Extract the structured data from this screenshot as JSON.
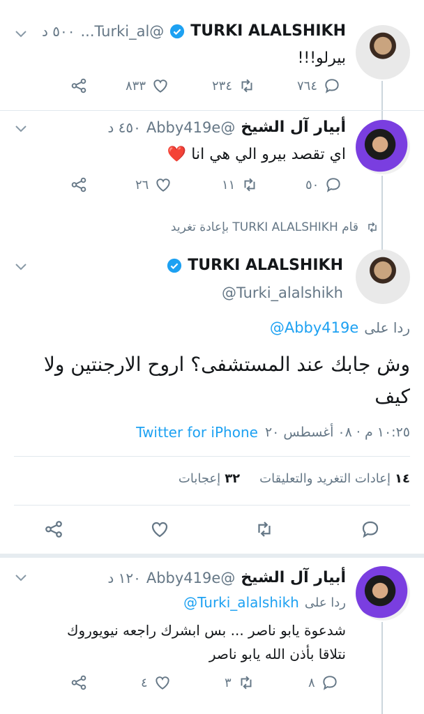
{
  "tweet1": {
    "name": "TURKI ALALSHIKH",
    "handle": "@Turki_al...",
    "time": "٥٠٠ د",
    "text": "بيرلو!!!",
    "replies": "٧٦٤",
    "retweets": "٢٣٤",
    "likes": "٨٣٣"
  },
  "tweet2": {
    "name": "أبيار آل الشيخ",
    "handle": "@Abby419e",
    "time": "٤٥٠ د",
    "text": "اي تقصد بيرو الي هي انا ❤️",
    "replies": "٥٠",
    "retweets": "١١",
    "likes": "٢٦"
  },
  "retweet_note": {
    "text": "قام TURKI ALALSHIKH بإعادة تغريد"
  },
  "main": {
    "name": "TURKI ALALSHIKH",
    "handle": "@Turki_alalshikh",
    "reply_prefix": "ردا على",
    "reply_to": "@Abby419e",
    "text": "وش جابك عند المستشفى؟ اروح الارجنتين ولا كيف",
    "timestamp": "١٠:٢٥ م · ٠٨ أغسطس ٢٠",
    "client": "Twitter for iPhone",
    "retweets_count": "١٤",
    "retweets_label": "إعادات التغريد والتعليقات",
    "likes_count": "٣٢",
    "likes_label": "إعجابات"
  },
  "tweet3": {
    "name": "أبيار آل الشيخ",
    "handle": "@Abby419e",
    "time": "١٢٠ د",
    "reply_prefix": "ردا على",
    "reply_to": "@Turki_alalshikh",
    "text_line1": "شدعوة يابو ناصر ... بس ابشرك راجعه نيويوروك",
    "text_line2": "نتلاقا بأذن الله يابو ناصر",
    "replies": "٨",
    "retweets": "٣",
    "likes": "٤"
  },
  "colors": {
    "accent": "#1da1f2",
    "secondary_text": "#657786",
    "heart": "#e0245e"
  }
}
